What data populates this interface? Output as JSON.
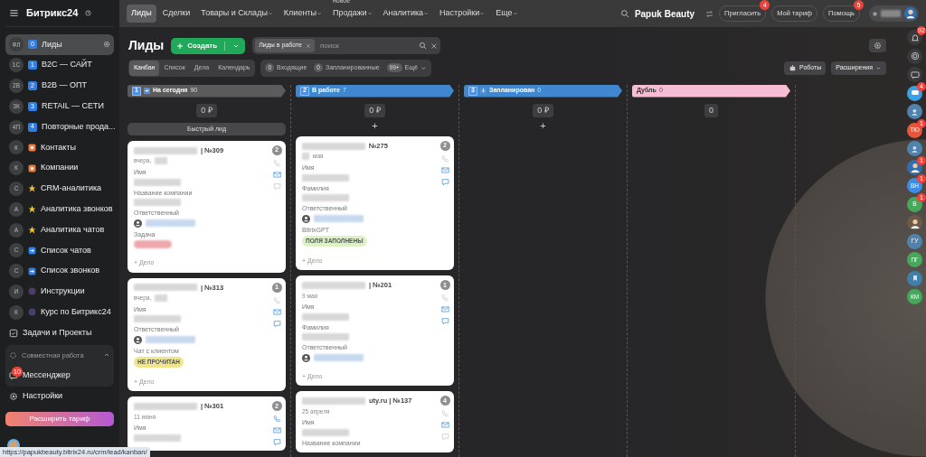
{
  "logo": "Битрикс24",
  "sidebar": {
    "items": [
      {
        "circle": "ФЛ",
        "kind": "counter",
        "mark": "0",
        "label": "Лиды",
        "selected": true
      },
      {
        "circle": "1С",
        "kind": "counter",
        "mark": "1",
        "label": "B2C — САЙТ",
        "selected": false
      },
      {
        "circle": "2В",
        "kind": "counter",
        "mark": "2",
        "label": "B2B — ОПТ",
        "selected": false
      },
      {
        "circle": "3К",
        "kind": "counter",
        "mark": "3",
        "label": "RETAIL — СЕТИ",
        "selected": false
      },
      {
        "circle": "4П",
        "kind": "counter",
        "mark": "4",
        "label": "Повторные прода...",
        "selected": false
      },
      {
        "circle": "К",
        "kind": "contact",
        "label": "Контакты",
        "selected": false
      },
      {
        "circle": "К",
        "kind": "contact",
        "label": "Компании",
        "selected": false
      },
      {
        "circle": "С",
        "kind": "star",
        "label": "CRM-аналитика",
        "selected": false
      },
      {
        "circle": "А",
        "kind": "star",
        "label": "Аналитика звонков",
        "selected": false
      },
      {
        "circle": "А",
        "kind": "star",
        "label": "Аналитика чатов",
        "selected": false
      },
      {
        "circle": "С",
        "kind": "arrow",
        "label": "Список чатов",
        "selected": false
      },
      {
        "circle": "С",
        "kind": "arrow",
        "label": "Список звонков",
        "selected": false
      },
      {
        "circle": "И",
        "kind": "dot",
        "label": "Инструкции",
        "selected": false
      },
      {
        "circle": "К",
        "kind": "dot",
        "label": "Курс по Битрикс24",
        "selected": false
      }
    ],
    "tasks": "Задачи и Проекты",
    "group": {
      "label": "Совместная работа",
      "expanded": true,
      "items": [
        {
          "label": "Мессенджер",
          "badge": "10"
        }
      ]
    },
    "settings": "Настройки",
    "upgrade": "Расширить тариф"
  },
  "status_url": "https://papukbeauty.bitrix24.ru/crm/lead/kanban/",
  "topnav": [
    {
      "label": "Лиды",
      "selected": true,
      "dropdown": false
    },
    {
      "label": "Сделки",
      "selected": false,
      "dropdown": false
    },
    {
      "label": "Товары и Склады",
      "selected": false,
      "dropdown": true
    },
    {
      "label": "Клиенты",
      "selected": false,
      "dropdown": true
    },
    {
      "label": "Продажи",
      "selected": false,
      "dropdown": true,
      "tag": "новое"
    },
    {
      "label": "Аналитика",
      "selected": false,
      "dropdown": true
    },
    {
      "label": "Настройки",
      "selected": false,
      "dropdown": true
    },
    {
      "label": "Еще",
      "selected": false,
      "dropdown": true
    }
  ],
  "company": "Papuk Beauty",
  "header_buttons": [
    {
      "label": "Пригласить",
      "badge": "4"
    },
    {
      "label": "Мой тариф"
    },
    {
      "label": "Помощь",
      "badge": "5"
    }
  ],
  "page_title": "Лиды",
  "create_button": "Создать",
  "filter": {
    "chip": "Лиды в работе",
    "placeholder": "поиск"
  },
  "views": [
    {
      "label": "Канбан",
      "selected": true
    },
    {
      "label": "Список",
      "selected": false
    },
    {
      "label": "Дела",
      "selected": false
    },
    {
      "label": "Календарь",
      "selected": false
    }
  ],
  "counters": [
    {
      "count": "0",
      "label": "Входящие"
    },
    {
      "count": "0",
      "label": "Запланированные"
    },
    {
      "count": "99+",
      "label": "Ещё"
    }
  ],
  "robots": "Роботы",
  "extensions": "Расширения",
  "columns": [
    {
      "num": "1",
      "title": "На сегодня",
      "count": "90",
      "color": "#5b5b5b",
      "sum": "0 ₽",
      "add": {
        "kind": "button",
        "label": "Быстрый лид"
      },
      "cards": [
        {
          "title": "| №309",
          "date": "вчера,",
          "blur_after": true,
          "counter": "2",
          "phone": false,
          "mail": true,
          "chat": false,
          "fields": [
            {
              "label": "Имя",
              "kind": "blur"
            },
            {
              "label": "Название компании",
              "kind": "blur"
            },
            {
              "label": "Ответственный",
              "kind": "person"
            },
            {
              "label": "Задача",
              "kind": "red_pill"
            }
          ],
          "add": "+ Дело"
        },
        {
          "title": "| №313",
          "date": "вчера,",
          "blur_after": true,
          "counter": "1",
          "phone": false,
          "mail": true,
          "chat": true,
          "fields": [
            {
              "label": "Имя",
              "kind": "blur"
            },
            {
              "label": "Ответственный",
              "kind": "person"
            },
            {
              "label": "Чат с клиентом",
              "kind": "tag",
              "tag": "НЕ ПРОЧИТАН",
              "color": "#efe58a"
            }
          ],
          "add": "+ Дело"
        },
        {
          "title": "| №301",
          "date": "11 июня",
          "counter": "2",
          "phone": true,
          "mail": true,
          "chat": true,
          "fields": [
            {
              "label": "Имя",
              "kind": "blur"
            }
          ]
        }
      ]
    },
    {
      "num": "2",
      "title": "В работе",
      "count": "7",
      "color": "#3f88d0",
      "sum": "0 ₽",
      "add": {
        "kind": "plus",
        "label": "+"
      },
      "cards": [
        {
          "title": "№275",
          "date": "мая",
          "blur_before": true,
          "counter": "2",
          "phone": false,
          "mail": true,
          "chat": true,
          "fields": [
            {
              "label": "Имя",
              "kind": "blur"
            },
            {
              "label": "Фамилия",
              "kind": "blur"
            },
            {
              "label": "Ответственный",
              "kind": "person"
            },
            {
              "label": "BitrixGPT",
              "kind": "tag",
              "tag": "ПОЛЯ ЗАПОЛНЕНЫ",
              "color": "#dcf2c4"
            }
          ],
          "add": "+ Дело"
        },
        {
          "title": "| №201",
          "date": "9 мая",
          "counter": "1",
          "phone": false,
          "mail": true,
          "chat": true,
          "fields": [
            {
              "label": "Имя",
              "kind": "blur"
            },
            {
              "label": "Фамилия",
              "kind": "blur"
            },
            {
              "label": "Ответственный",
              "kind": "person"
            }
          ],
          "add": "+ Дело"
        },
        {
          "title": "uty.ru | №137",
          "date": "25 апреля",
          "counter": "4",
          "phone": false,
          "mail": true,
          "chat": false,
          "fields": [
            {
              "label": "Имя",
              "kind": "blur"
            },
            {
              "label": "Название компании",
              "kind": "none"
            }
          ]
        }
      ]
    },
    {
      "num": "3",
      "title": "Запланирован",
      "count": "0",
      "color": "#3f88d0",
      "sum": "0 ₽",
      "add": {
        "kind": "plus",
        "label": "+"
      }
    },
    {
      "title": "Дубль",
      "count": "0",
      "color": "#f6bdd4",
      "sum": "0"
    }
  ],
  "rail": [
    {
      "kind": "bell",
      "badge": "92"
    },
    {
      "kind": "ai"
    },
    {
      "kind": "chat"
    },
    {
      "kind": "app",
      "color": "#3aa0e8",
      "badge": "4"
    },
    {
      "kind": "user",
      "color": "#4f83ad"
    },
    {
      "kind": "initials",
      "text": "ТЮ",
      "color": "#e8553a",
      "badge": "1"
    },
    {
      "kind": "user",
      "color": "#4f83ad"
    },
    {
      "kind": "avatar",
      "color": "#2f6fb0",
      "badge": "1"
    },
    {
      "kind": "initials",
      "text": "ВН",
      "color": "#3a8ee8",
      "badge": "1"
    },
    {
      "kind": "initials",
      "text": "В",
      "color": "#46a85a",
      "badge": "1"
    },
    {
      "kind": "avatar",
      "color": "#6b5a48"
    },
    {
      "kind": "initials",
      "text": "ГУ",
      "color": "#4f83ad"
    },
    {
      "kind": "initials",
      "text": "ПГ",
      "color": "#46a85a"
    },
    {
      "kind": "bookmark",
      "color": "#3f7fa8"
    },
    {
      "kind": "initials",
      "text": "КМ",
      "color": "#46a85a"
    }
  ]
}
